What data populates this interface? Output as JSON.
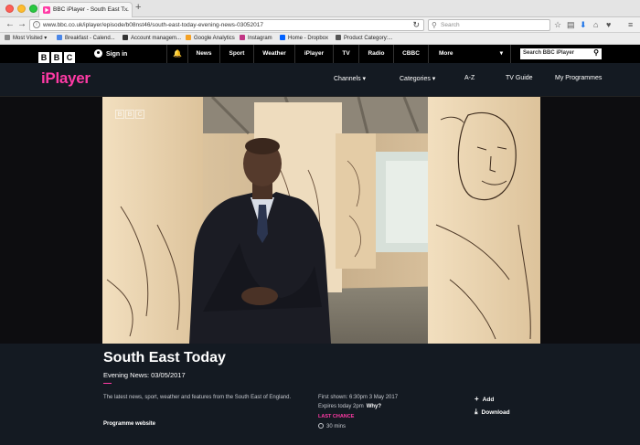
{
  "browser": {
    "tab_title": "BBC iPlayer - South East T...",
    "url": "www.bbc.co.uk/iplayer/episode/b08nst46/south-east-today-evening-news-03052017",
    "search_placeholder": "Search",
    "bookmarks": [
      {
        "label": "Most Visited ▾",
        "icon_color": "#8b8b8b"
      },
      {
        "label": "Breakfast - Calend...",
        "icon_color": "#4a86e8"
      },
      {
        "label": "Account managem...",
        "icon_color": "#333333"
      },
      {
        "label": "Google Analytics",
        "icon_color": "#f4a124"
      },
      {
        "label": "Instagram",
        "icon_color": "#c13584"
      },
      {
        "label": "Home - Dropbox",
        "icon_color": "#0061ff"
      },
      {
        "label": "Product Category:...",
        "icon_color": "#555555"
      }
    ]
  },
  "bbc": {
    "logo_letters": [
      "B",
      "B",
      "C"
    ],
    "signin": "Sign in",
    "nav": [
      "News",
      "Sport",
      "Weather",
      "iPlayer",
      "TV",
      "Radio",
      "CBBC",
      "More"
    ],
    "search_placeholder": "Search BBC iPlayer"
  },
  "iplayer": {
    "logo": "iPlayer",
    "nav": [
      "Channels ▾",
      "Categories ▾",
      "A-Z",
      "TV Guide",
      "My Programmes"
    ],
    "accent": "#ff3aa5"
  },
  "programme": {
    "title": "South East Today",
    "subtitle": "Evening News: 03/05/2017",
    "description": "The latest news, sport, weather and features from the South East of England.",
    "website_link": "Programme website",
    "first_shown": "First shown: 6:30pm 3 May 2017",
    "expires": "Expires today 2pm",
    "why": "Why?",
    "last_chance": "LAST CHANCE",
    "duration": "30 mins",
    "add": "Add",
    "download": "Download"
  }
}
